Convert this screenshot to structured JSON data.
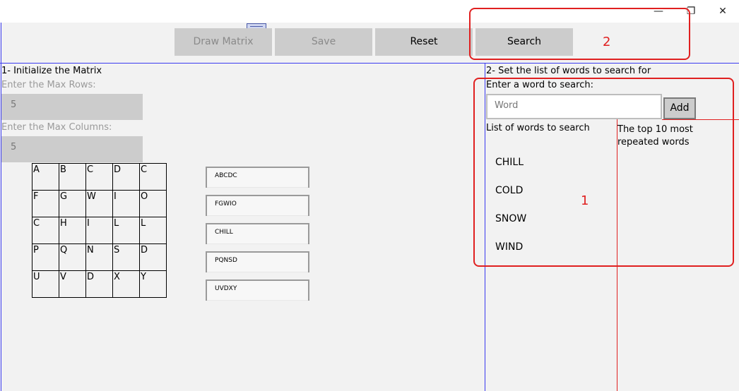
{
  "window": {
    "minimize_glyph": "—",
    "maximize_glyph": "❐",
    "close_glyph": "✕"
  },
  "toolbar": {
    "draw_matrix": "Draw Matrix",
    "save": "Save",
    "reset": "Reset",
    "search": "Search"
  },
  "section1": {
    "title": "1- Initialize the Matrix",
    "max_rows_label": "Enter the Max Rows:",
    "max_rows_value": "5",
    "max_cols_label": "Enter the Max Columns:",
    "max_cols_value": "5"
  },
  "matrix": {
    "rows": [
      [
        "A",
        "B",
        "C",
        "D",
        "C"
      ],
      [
        "F",
        "G",
        "W",
        "I",
        "O"
      ],
      [
        "C",
        "H",
        "I",
        "L",
        "L"
      ],
      [
        "P",
        "Q",
        "N",
        "S",
        "D"
      ],
      [
        "U",
        "V",
        "D",
        "X",
        "Y"
      ]
    ],
    "row_strings": [
      "ABCDC",
      "FGWIO",
      "CHILL",
      "PQNSD",
      "UVDXY"
    ]
  },
  "section2": {
    "title": "2- Set the list of words to search for",
    "enter_word_label": "Enter a word to search:",
    "word_placeholder": "Word",
    "add_button": "Add",
    "list_header": "List of words to search",
    "top10_header": "The top 10 most repeated words",
    "words": [
      "CHILL",
      "COLD",
      "SNOW",
      "WIND"
    ]
  },
  "annotations": {
    "label_1": "1",
    "label_2": "2",
    "color": "#e02020"
  }
}
